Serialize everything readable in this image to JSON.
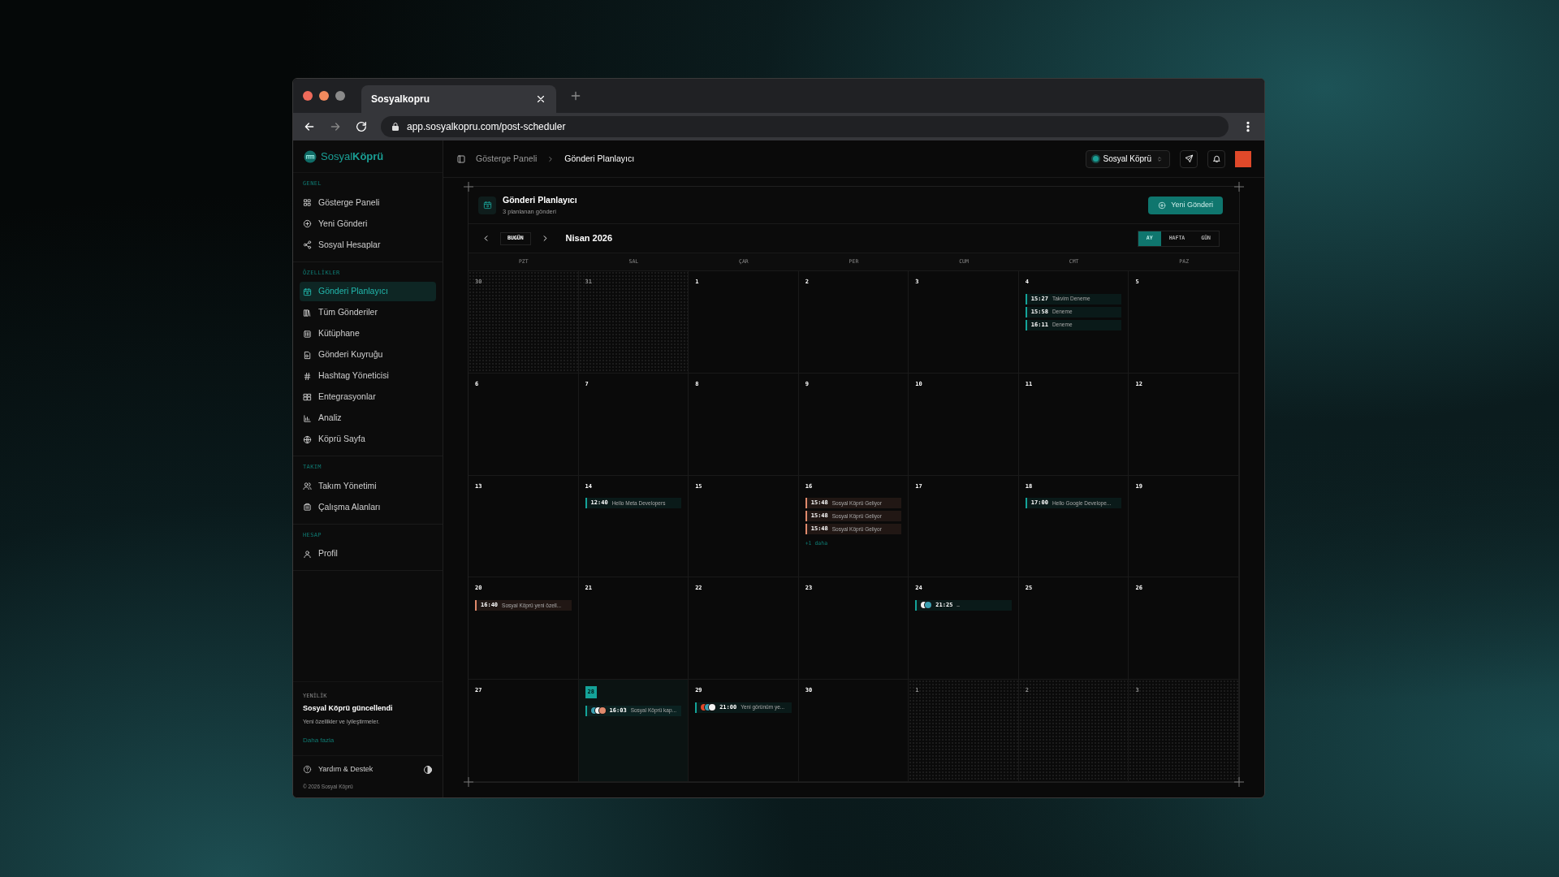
{
  "browser": {
    "tab_title": "Sosyalkopru",
    "url": "app.sosyalkopru.com/post-scheduler"
  },
  "sidebar": {
    "logo": "Sosyal**Köprü**",
    "sections": [
      {
        "title": "GENEL",
        "items": [
          {
            "label": "Gösterge Paneli",
            "selected": false
          },
          {
            "label": "Yeni Gönderi",
            "selected": false
          },
          {
            "label": "Sosyal Hesaplar",
            "selected": false
          }
        ]
      },
      {
        "title": "ÖZELLİKLER",
        "items": [
          {
            "label": "Gönderi Planlayıcı",
            "selected": true
          },
          {
            "label": "Tüm Gönderiler",
            "selected": false
          },
          {
            "label": "Kütüphane",
            "selected": false
          },
          {
            "label": "Gönderi Kuyruğu",
            "selected": false
          },
          {
            "label": "Hashtag Yöneticisi",
            "selected": false
          },
          {
            "label": "Entegrasyonlar",
            "selected": false
          },
          {
            "label": "Analiz",
            "selected": false
          },
          {
            "label": "Köprü Sayfa",
            "selected": false
          }
        ]
      },
      {
        "title": "TAKIM",
        "items": [
          {
            "label": "Takım Yönetimi",
            "selected": false
          },
          {
            "label": "Çalışma Alanları",
            "selected": false
          }
        ]
      },
      {
        "title": "HESAP",
        "items": [
          {
            "label": "Profil",
            "selected": false
          }
        ]
      }
    ],
    "news": {
      "tag": "YENİLİK",
      "title": "Sosyal Köprü güncellendi",
      "text": "Yeni özellikler ve iyileştirmeler.",
      "link": "Daha fazla"
    },
    "help": "Yardım & Destek",
    "copyright": "© 2026 Sosyal Köprü"
  },
  "header": {
    "breadcrumb": [
      "Gösterge Paneli",
      "Gönderi Planlayıcı"
    ],
    "workspace": "Sosyal Köprü"
  },
  "page": {
    "title": "Gönderi Planlayıcı",
    "subtitle": "3 planlanan gönderi",
    "new_button": "Yeni Gönderi"
  },
  "calendar": {
    "today_button": "BUGÜN",
    "month": "Nisan 2026",
    "views": [
      {
        "label": "AY",
        "selected": true
      },
      {
        "label": "HAFTA",
        "selected": false
      },
      {
        "label": "GÜN",
        "selected": false
      }
    ],
    "weekdays": [
      "PZT",
      "SAL",
      "ÇAR",
      "PER",
      "CUM",
      "CMT",
      "PAZ"
    ],
    "days": [
      {
        "day": "30",
        "muted": true,
        "today": false
      },
      {
        "day": "31",
        "muted": true,
        "today": false
      },
      {
        "day": "1",
        "muted": false,
        "today": false
      },
      {
        "day": "2",
        "muted": false,
        "today": false
      },
      {
        "day": "3",
        "muted": false,
        "today": false
      },
      {
        "day": "4",
        "muted": false,
        "today": false,
        "events": [
          {
            "time": "15:27",
            "title": "Takvim Deneme",
            "color": "#14a399"
          },
          {
            "time": "15:58",
            "title": "Deneme",
            "color": "#14a399"
          },
          {
            "time": "16:11",
            "title": "Deneme",
            "color": "#14a399"
          }
        ]
      },
      {
        "day": "5",
        "muted": false,
        "today": false
      },
      {
        "day": "6",
        "muted": false,
        "today": false
      },
      {
        "day": "7",
        "muted": false,
        "today": false
      },
      {
        "day": "8",
        "muted": false,
        "today": false
      },
      {
        "day": "9",
        "muted": false,
        "today": false
      },
      {
        "day": "10",
        "muted": false,
        "today": false
      },
      {
        "day": "11",
        "muted": false,
        "today": false
      },
      {
        "day": "12",
        "muted": false,
        "today": false
      },
      {
        "day": "13",
        "muted": false,
        "today": false
      },
      {
        "day": "14",
        "muted": false,
        "today": false,
        "events": [
          {
            "time": "12:40",
            "title": "Hello Meta Developers",
            "color": "#14a399"
          }
        ]
      },
      {
        "day": "15",
        "muted": false,
        "today": false
      },
      {
        "day": "16",
        "muted": false,
        "today": false,
        "events": [
          {
            "time": "15:48",
            "title": "Sosyal Köprü Geliyor",
            "color": "#e08a6c"
          },
          {
            "time": "15:48",
            "title": "Sosyal Köprü Geliyor",
            "color": "#e08a6c"
          },
          {
            "time": "15:48",
            "title": "Sosyal Köprü Geliyor",
            "color": "#e08a6c"
          }
        ],
        "more": "+1 daha"
      },
      {
        "day": "17",
        "muted": false,
        "today": false
      },
      {
        "day": "18",
        "muted": false,
        "today": false,
        "events": [
          {
            "time": "17:00",
            "title": "Hello Google Develope...",
            "color": "#14a399"
          }
        ]
      },
      {
        "day": "19",
        "muted": false,
        "today": false
      },
      {
        "day": "20",
        "muted": false,
        "today": false,
        "events": [
          {
            "time": "16:40",
            "title": "Sosyal Köprü yeni özell...",
            "color": "#e08a6c"
          }
        ]
      },
      {
        "day": "21",
        "muted": false,
        "today": false
      },
      {
        "day": "22",
        "muted": false,
        "today": false
      },
      {
        "day": "23",
        "muted": false,
        "today": false
      },
      {
        "day": "24",
        "muted": false,
        "today": false,
        "events": [
          {
            "time": "21:25",
            "title": "–",
            "color": "#14a399",
            "avatars": [
              {
                "color": "#f2f2f2"
              },
              {
                "color": "#3a9fb0"
              }
            ]
          }
        ]
      },
      {
        "day": "25",
        "muted": false,
        "today": false
      },
      {
        "day": "26",
        "muted": false,
        "today": false
      },
      {
        "day": "27",
        "muted": false,
        "today": false
      },
      {
        "day": "28",
        "muted": false,
        "today": true,
        "events": [
          {
            "time": "16:03",
            "title": "Sosyal Köprü kap...",
            "color": "#14a399",
            "avatars": [
              {
                "color": "#3a9fb0"
              },
              {
                "color": "#f2f2f2"
              },
              {
                "color": "#e08a6c"
              }
            ]
          }
        ]
      },
      {
        "day": "29",
        "muted": false,
        "today": false,
        "events": [
          {
            "time": "21:00",
            "title": "Yeni görünüm ye...",
            "color": "#14a399",
            "avatars": [
              {
                "color": "#e0492a"
              },
              {
                "color": "#3a9fb0"
              },
              {
                "color": "#f2f2f2"
              }
            ]
          }
        ]
      },
      {
        "day": "30",
        "muted": false,
        "today": false
      },
      {
        "day": "1",
        "muted": true,
        "today": false
      },
      {
        "day": "2",
        "muted": true,
        "today": false
      },
      {
        "day": "3",
        "muted": true,
        "today": false
      }
    ]
  }
}
